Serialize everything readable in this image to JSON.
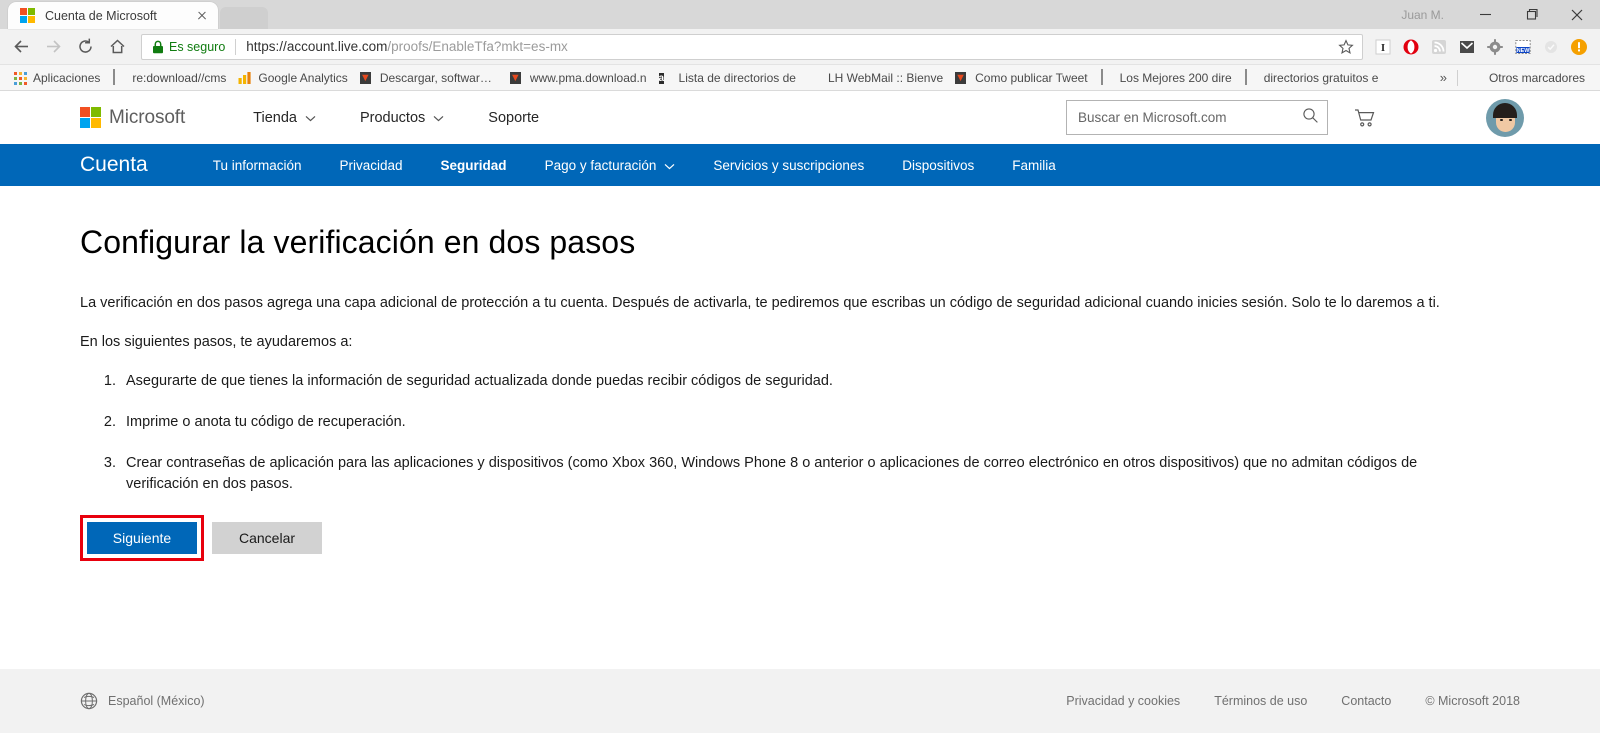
{
  "browser": {
    "tab": {
      "title": "Cuenta de Microsoft",
      "favicon": "microsoft-logo-icon",
      "close": "×"
    },
    "window": {
      "profile_name": "Juan M.",
      "minimize": "minimize-icon",
      "maximize": "maximize-icon",
      "close": "close-icon"
    },
    "toolbar": {
      "back": "back-arrow-icon",
      "forward": "forward-arrow-icon",
      "reload": "reload-icon",
      "home": "home-icon",
      "secure_label": "Es seguro",
      "url_scheme": "https://",
      "url_host": "account.live.com",
      "url_path": "/proofs/EnableTfa?mkt=es-mx",
      "url_full": "https://account.live.com/proofs/EnableTfa?mkt=es-mx",
      "bookmark_star": "star-icon",
      "extensions": [
        {
          "name": "extension-i-icon",
          "glyph": "I"
        },
        {
          "name": "opera-shield-icon",
          "glyph": ""
        },
        {
          "name": "rss-feed-icon",
          "glyph": ""
        },
        {
          "name": "gmail-icon",
          "glyph": "M"
        },
        {
          "name": "gear-icon",
          "glyph": ""
        },
        {
          "name": "new-badge-icon",
          "glyph": "NEW"
        },
        {
          "name": "check-circle-icon",
          "glyph": ""
        },
        {
          "name": "alert-icon",
          "glyph": "!"
        }
      ]
    },
    "bookmarks": [
      {
        "label": "Aplicaciones",
        "icon": "apps-grid-icon"
      },
      {
        "label": "re:download//cms",
        "icon": "document-icon"
      },
      {
        "label": "Google Analytics",
        "icon": "google-analytics-icon"
      },
      {
        "label": "Descargar, software, c",
        "icon": "firefox-monster-icon"
      },
      {
        "label": "www.pma.download.n",
        "icon": "firefox-monster-icon"
      },
      {
        "label": "Lista de directorios de",
        "icon": "amazon-icon"
      },
      {
        "label": "LH WebMail :: Bienve",
        "icon": "globe-icon"
      },
      {
        "label": "Como publicar Tweet",
        "icon": "firefox-monster-icon"
      },
      {
        "label": "Los Mejores 200 dire",
        "icon": "document-icon"
      },
      {
        "label": "directorios gratuitos e",
        "icon": "document-icon"
      }
    ],
    "bookmarks_overflow": "»",
    "other_bookmarks": {
      "label": "Otros marcadores",
      "icon": "folder-icon"
    }
  },
  "site_header": {
    "logo_text": "Microsoft",
    "logo_icon": "microsoft-logo-icon",
    "nav": [
      {
        "label": "Tienda",
        "has_caret": true
      },
      {
        "label": "Productos",
        "has_caret": true
      },
      {
        "label": "Soporte",
        "has_caret": false
      }
    ],
    "search": {
      "placeholder": "Buscar en Microsoft.com",
      "value": "",
      "icon": "search-icon"
    },
    "cart_icon": "shopping-cart-icon",
    "avatar": "user-avatar"
  },
  "account_nav": {
    "brand": "Cuenta",
    "items": [
      {
        "label": "Tu información",
        "active": false,
        "has_caret": false
      },
      {
        "label": "Privacidad",
        "active": false,
        "has_caret": false
      },
      {
        "label": "Seguridad",
        "active": true,
        "has_caret": false
      },
      {
        "label": "Pago y facturación",
        "active": false,
        "has_caret": true
      },
      {
        "label": "Servicios y suscripciones",
        "active": false,
        "has_caret": false
      },
      {
        "label": "Dispositivos",
        "active": false,
        "has_caret": false
      },
      {
        "label": "Familia",
        "active": false,
        "has_caret": false
      }
    ]
  },
  "main": {
    "title": "Configurar la verificación en dos pasos",
    "intro": "La verificación en dos pasos agrega una capa adicional de protección a tu cuenta. Después de activarla, te pediremos que escribas un código de seguridad adicional cuando inicies sesión. Solo te lo daremos a ti.",
    "subintro": "En los siguientes pasos, te ayudaremos a:",
    "steps": [
      "Asegurarte de que tienes la información de seguridad actualizada donde puedas recibir códigos de seguridad.",
      "Imprime o anota tu código de recuperación.",
      "Crear contraseñas de aplicación para las aplicaciones y dispositivos (como Xbox 360, Windows Phone 8 o anterior o aplicaciones de correo electrónico en otros dispositivos) que no admitan códigos de verificación en dos pasos."
    ],
    "primary_button": "Siguiente",
    "secondary_button": "Cancelar",
    "highlight_color": "#e8000d"
  },
  "footer": {
    "language": "Español (México)",
    "language_icon": "globe-icon",
    "links": [
      "Privacidad y cookies",
      "Términos de uso",
      "Contacto"
    ],
    "copyright": "© Microsoft 2018"
  },
  "colors": {
    "ms_blue": "#0067b8",
    "secure_green": "#107c10",
    "highlight_red": "#e8000d"
  }
}
